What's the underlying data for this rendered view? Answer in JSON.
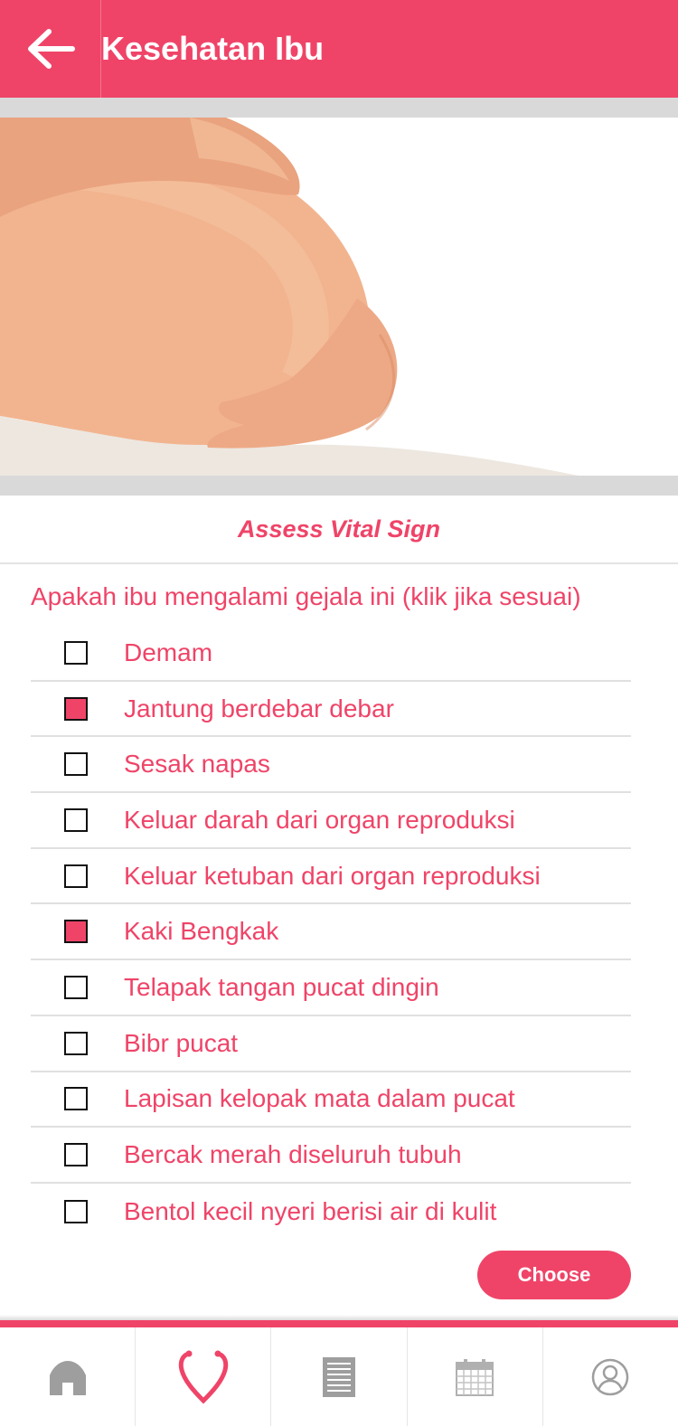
{
  "header": {
    "title": "Kesehatan Ibu",
    "back_icon": "arrow-left-icon"
  },
  "section": {
    "title": "Assess Vital Sign"
  },
  "question": "Apakah ibu mengalami gejala ini (klik jika sesuai)",
  "symptoms": [
    {
      "label": "Demam",
      "checked": false
    },
    {
      "label": "Jantung berdebar debar",
      "checked": true
    },
    {
      "label": "Sesak napas",
      "checked": false
    },
    {
      "label": "Keluar darah dari organ reproduksi",
      "checked": false
    },
    {
      "label": "Keluar ketuban dari organ reproduksi",
      "checked": false
    },
    {
      "label": "Kaki Bengkak",
      "checked": true
    },
    {
      "label": "Telapak tangan pucat dingin",
      "checked": false
    },
    {
      "label": "Bibr pucat",
      "checked": false
    },
    {
      "label": "Lapisan kelopak mata dalam pucat",
      "checked": false
    },
    {
      "label": "Bercak merah diseluruh tubuh",
      "checked": false
    },
    {
      "label": "Bentol kecil nyeri berisi air di kulit",
      "checked": false
    }
  ],
  "actions": {
    "choose_label": "Choose"
  },
  "bottom_nav": [
    {
      "icon": "home-icon",
      "active": false
    },
    {
      "icon": "stethoscope-icon",
      "active": true
    },
    {
      "icon": "document-icon",
      "active": false
    },
    {
      "icon": "calendar-icon",
      "active": false
    },
    {
      "icon": "profile-icon",
      "active": false
    }
  ],
  "colors": {
    "accent": "#ef4468",
    "inactive_icon": "#9e9e9e"
  }
}
